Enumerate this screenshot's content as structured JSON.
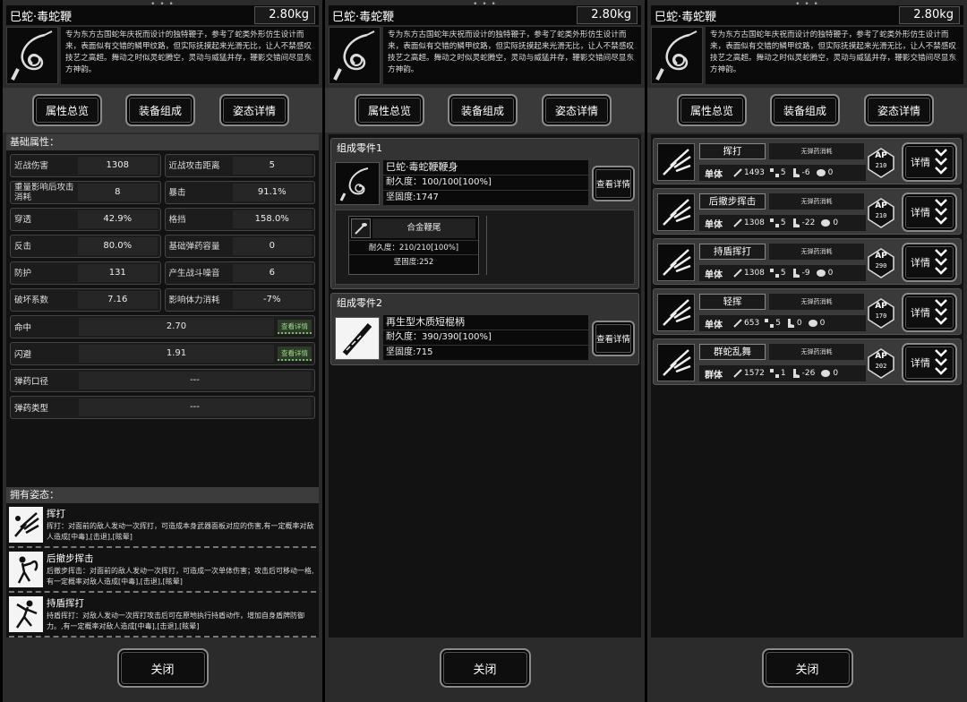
{
  "weapon": {
    "name": "巳蛇·毒蛇鞭",
    "weight": "2.80kg",
    "description": "专为东方古国蛇年庆祝而设计的独特鞭子，参考了蛇类外形仿生设计而来，表面似有交错的鳞甲纹路，但实际抚摸起来光滑无比，让人不禁感叹技艺之高超。舞动之时似灵蛇腾空，灵动与威猛并存，鞭影交错间尽显东方神韵。"
  },
  "tabs": [
    "属性总览",
    "装备组成",
    "姿态详情"
  ],
  "close_label": "关闭",
  "attributes": {
    "title": "基础属性：",
    "pairs": [
      [
        {
          "label": "近战伤害",
          "value": "1308"
        },
        {
          "label": "近战攻击距离",
          "value": "5"
        }
      ],
      [
        {
          "label": "重量影响后攻击消耗",
          "value": "8"
        },
        {
          "label": "暴击",
          "value": "91.1%"
        }
      ],
      [
        {
          "label": "穿透",
          "value": "42.9%"
        },
        {
          "label": "格挡",
          "value": "158.0%"
        }
      ],
      [
        {
          "label": "反击",
          "value": "80.0%"
        },
        {
          "label": "基础弹药容量",
          "value": "0"
        }
      ],
      [
        {
          "label": "防护",
          "value": "131"
        },
        {
          "label": "产生战斗噪音",
          "value": "6"
        }
      ],
      [
        {
          "label": "破坏系数",
          "value": "7.16"
        },
        {
          "label": "影响体力消耗",
          "value": "-7%"
        }
      ]
    ],
    "full": [
      {
        "label": "命中",
        "value": "2.70",
        "more": "查看详情"
      },
      {
        "label": "闪避",
        "value": "1.91",
        "more": "查看详情"
      },
      {
        "label": "弹药口径",
        "value": "---",
        "more": ""
      },
      {
        "label": "弹药类型",
        "value": "---",
        "more": ""
      }
    ]
  },
  "poses": {
    "title": "拥有姿态：",
    "items": [
      {
        "name": "挥打",
        "desc": "挥打：对面前的敌人发动一次挥打，可造成本身武器面板对应的伤害,有一定概率对敌人造成[中毒],[击退],[眩晕]"
      },
      {
        "name": "后撤步挥击",
        "desc": "后撤步挥击：对面前的敌人发动一次挥打，可造成一次单体伤害；攻击后可移动一格,有一定概率对敌人造成[中毒],[击退],[眩晕]"
      },
      {
        "name": "持盾挥打",
        "desc": "持盾挥打：对敌人发动一次挥打攻击后可在原地执行持盾动作，增加自身盾牌防御力。,有一定概率对敌人造成[中毒],[击退],[眩晕]"
      }
    ]
  },
  "parts": [
    {
      "header": "组成零件1",
      "name": "巳蛇·毒蛇鞭鞭身",
      "durability": "耐久度：100/100[100%]",
      "hardness": "坚固度:1747",
      "view": "查看详情",
      "sub": {
        "name": "合金鞭尾",
        "durability": "耐久度：210/210[100%]",
        "hardness": "坚固度:252"
      }
    },
    {
      "header": "组成零件2",
      "name": "再生型木质短棍柄",
      "durability": "耐久度：390/390[100%]",
      "hardness": "坚固度:715",
      "view": "查看详情"
    }
  ],
  "skills": [
    {
      "name": "挥打",
      "ammo": "无弹药消耗",
      "target": "单体",
      "dmg": "1493",
      "range": "5",
      "move": "-6",
      "shield": "0",
      "ap_label": "AP",
      "ap": "210",
      "detail": "详情"
    },
    {
      "name": "后撤步挥击",
      "ammo": "无弹药消耗",
      "target": "单体",
      "dmg": "1308",
      "range": "5",
      "move": "-22",
      "shield": "0",
      "ap_label": "AP",
      "ap": "210",
      "detail": "详情"
    },
    {
      "name": "持盾挥打",
      "ammo": "无弹药消耗",
      "target": "单体",
      "dmg": "1308",
      "range": "5",
      "move": "-9",
      "shield": "0",
      "ap_label": "AP",
      "ap": "290",
      "detail": "详情"
    },
    {
      "name": "轻挥",
      "ammo": "无弹药消耗",
      "target": "单体",
      "dmg": "653",
      "range": "5",
      "move": "0",
      "shield": "0",
      "ap_label": "AP",
      "ap": "170",
      "detail": "详情"
    },
    {
      "name": "群蛇乱舞",
      "ammo": "无弹药消耗",
      "target": "群体",
      "dmg": "1572",
      "range": "1",
      "move": "-26",
      "shield": "0",
      "ap_label": "AP",
      "ap": "202",
      "detail": "详情"
    }
  ],
  "icons": {
    "weapon": "whip-icon",
    "attack": "sword-icon",
    "range": "range-icon",
    "move": "boot-icon",
    "shield": "turtle-icon",
    "detail": "chevron-down-icon"
  }
}
